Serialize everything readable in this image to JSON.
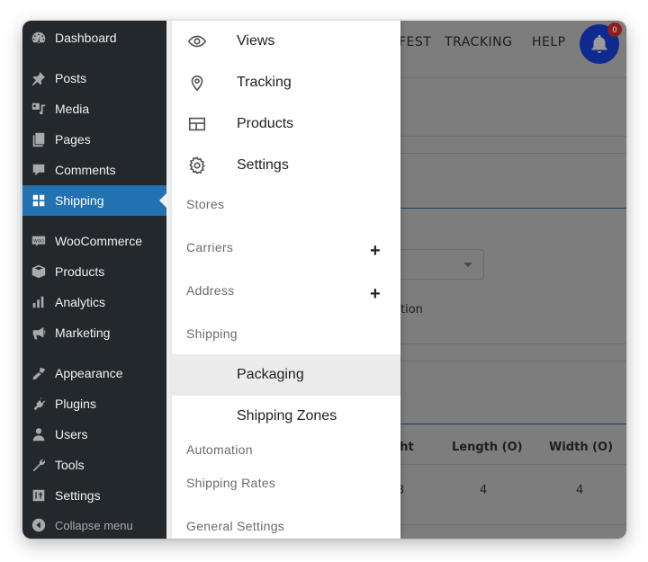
{
  "sidebar": {
    "items": [
      {
        "label": "Dashboard",
        "icon": "dashboard-icon"
      },
      {
        "label": "Posts",
        "icon": "pin-icon"
      },
      {
        "label": "Media",
        "icon": "media-icon"
      },
      {
        "label": "Pages",
        "icon": "pages-icon"
      },
      {
        "label": "Comments",
        "icon": "comment-icon"
      },
      {
        "label": "Shipping",
        "icon": "grid-icon",
        "active": true
      },
      {
        "label": "WooCommerce",
        "icon": "woo-icon"
      },
      {
        "label": "Products",
        "icon": "box-icon"
      },
      {
        "label": "Analytics",
        "icon": "bar-chart-icon"
      },
      {
        "label": "Marketing",
        "icon": "megaphone-icon"
      },
      {
        "label": "Appearance",
        "icon": "brush-icon"
      },
      {
        "label": "Plugins",
        "icon": "plug-icon"
      },
      {
        "label": "Users",
        "icon": "user-icon"
      },
      {
        "label": "Tools",
        "icon": "wrench-icon"
      },
      {
        "label": "Settings",
        "icon": "sliders-icon"
      }
    ],
    "collapse_label": "Collapse menu"
  },
  "panel": {
    "top_items": [
      {
        "label": "Views",
        "icon": "eye-icon"
      },
      {
        "label": "Tracking",
        "icon": "location-pin-icon"
      },
      {
        "label": "Products",
        "icon": "layout-icon"
      },
      {
        "label": "Settings",
        "icon": "gear-icon"
      }
    ],
    "sections": {
      "stores": "Stores",
      "carriers": "Carriers",
      "address": "Address",
      "shipping": "Shipping",
      "automation": "Automation",
      "shipping_rates": "Shipping Rates",
      "general_settings": "General Settings"
    },
    "expand_symbol": "+",
    "shipping_subitems": [
      {
        "label": "Packaging",
        "active": true
      },
      {
        "label": "Shipping Zones",
        "active": false
      }
    ]
  },
  "background": {
    "nav": [
      "FEST",
      "TRACKING",
      "HELP"
    ],
    "notification_count": "0",
    "partial_label": "tion",
    "table": {
      "headers": [
        "ght",
        "Length (O)",
        "Width (O)"
      ],
      "row": [
        "3",
        "4",
        "4"
      ]
    }
  },
  "colors": {
    "sidebar_bg": "#23282d",
    "active_blue": "#2271b1",
    "bell_blue": "#0f2a8f",
    "badge_red": "#8e1d1d"
  }
}
